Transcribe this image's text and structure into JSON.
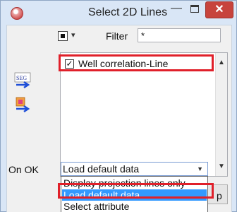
{
  "window": {
    "title": "Select 2D Lines",
    "minimize_glyph": "—",
    "close_glyph": "✕"
  },
  "toolbar": {
    "filter_label": "Filter",
    "filter_value": "*"
  },
  "list": {
    "items": [
      {
        "label": "Well correlation-Line",
        "checked": true,
        "check_glyph": "✓"
      }
    ],
    "scroll_up_glyph": "▲",
    "scroll_down_glyph": "▼"
  },
  "onok": {
    "label": "On OK",
    "selected": "Load default data",
    "caret": "▼",
    "options": [
      "Display projection lines only",
      "Load default data",
      "Select attribute"
    ]
  },
  "hidden_button_letter": "p",
  "icons": {
    "app": "app-logo-icon",
    "sel": "select-toggle-icon",
    "seg": "seg-import-icon",
    "pick": "pick-import-icon"
  },
  "colors": {
    "highlight_box": "#e0202a",
    "selected_option": "#3399ff",
    "close_button": "#c7433c"
  }
}
